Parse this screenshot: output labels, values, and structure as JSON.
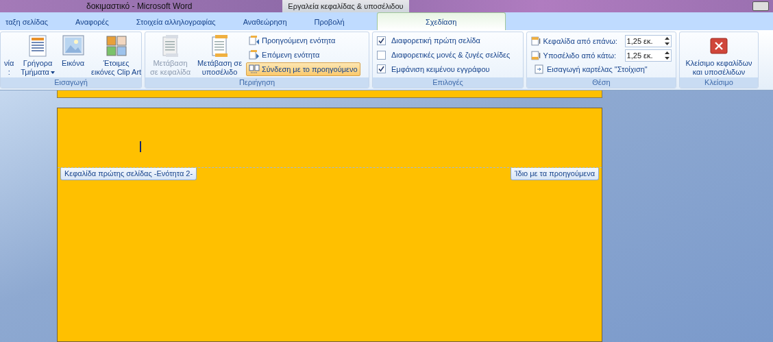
{
  "window": {
    "title": "δοκιμαστικό - Microsoft Word",
    "contextual_group": "Εργαλεία κεφαλίδας & υποσέλιδου"
  },
  "tabs": [
    {
      "label": "ταξη σελίδας",
      "selected": false
    },
    {
      "label": "Αναφορές",
      "selected": false
    },
    {
      "label": "Στοιχεία αλληλογραφίας",
      "selected": false
    },
    {
      "label": "Αναθεώρηση",
      "selected": false
    },
    {
      "label": "Προβολή",
      "selected": false
    },
    {
      "label": "Σχεδίαση",
      "selected": true,
      "kind": "contextual"
    }
  ],
  "insert_group": {
    "label": "Εισαγωγή",
    "buttons": [
      {
        "label": "νία\n:",
        "kind": "cut"
      },
      {
        "label": "Γρήγορα\nΤμήματα",
        "kind": "parts",
        "dropdown": true
      },
      {
        "label": "Εικόνα",
        "kind": "picture"
      },
      {
        "label": "Έτοιμες\nεικόνες Clip Art",
        "kind": "clipart"
      }
    ]
  },
  "navigation_group": {
    "label": "Περιήγηση",
    "large_buttons": [
      {
        "label": "Μετάβαση\nσε κεφαλίδα",
        "disabled": true
      },
      {
        "label": "Μετάβαση σε\nυποσέλιδο",
        "disabled": false
      }
    ],
    "small_buttons": [
      {
        "label": "Προηγούμενη ενότητα",
        "selected": false,
        "kind": "prev"
      },
      {
        "label": "Επόμενη ενότητα",
        "selected": false,
        "kind": "next"
      },
      {
        "label": "Σύνδεση με το προηγούμενο",
        "selected": true,
        "kind": "link"
      }
    ]
  },
  "options_group": {
    "label": "Επιλογές",
    "options": [
      {
        "label": "Διαφορετική πρώτη σελίδα",
        "checked": true
      },
      {
        "label": "Διαφορετικές μονές & ζυγές σελίδες",
        "checked": false
      },
      {
        "label": "Εμφάνιση κειμένου εγγράφου",
        "checked": true
      }
    ]
  },
  "position_group": {
    "label": "Θέση",
    "fields": [
      {
        "label": "Κεφαλίδα από επάνω:",
        "value": "1,25 εκ.",
        "kind": "header"
      },
      {
        "label": "Υποσέλιδο από κάτω:",
        "value": "1,25 εκ.",
        "kind": "footer"
      }
    ],
    "insert_tab": "Εισαγωγή καρτέλας \"Στοίχιση\""
  },
  "close_group": {
    "label": "Κλείσιμο",
    "button": "Κλείσιμο κεφαλίδων\nκαι υποσέλιδων"
  },
  "page": {
    "header_tag": "Κεφαλίδα πρώτης σελίδας -Ενότητα 2-",
    "link_tag": "Ίδιο με τα προηγούμενα"
  }
}
